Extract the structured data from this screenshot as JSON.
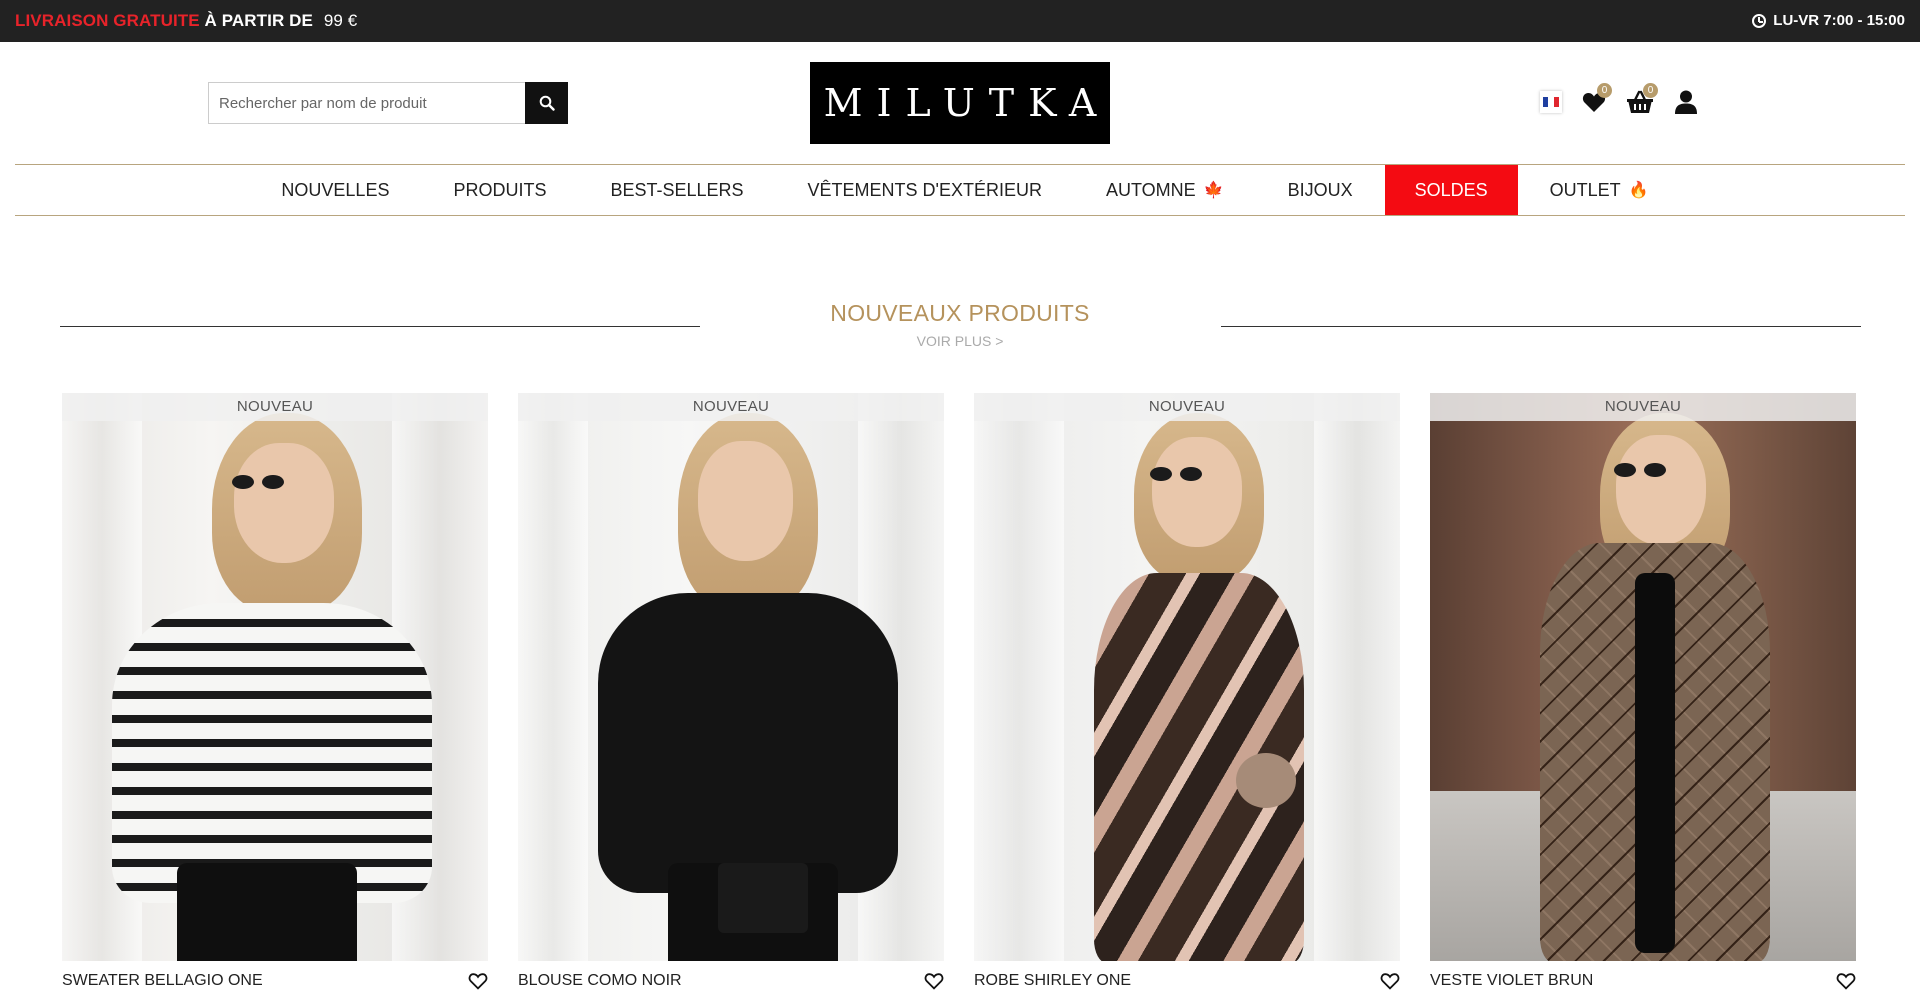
{
  "topbar": {
    "promo_red": "LIVRAISON GRATUITE",
    "promo_white": "À PARTIR DE",
    "promo_price": "99 €",
    "hours": "LU-VR 7:00 - 15:00"
  },
  "header": {
    "search_placeholder": "Rechercher par nom de produit",
    "logo_text": "MILUTKA",
    "wishlist_count": "0",
    "cart_count": "0"
  },
  "nav": {
    "items": [
      {
        "label": "NOUVELLES"
      },
      {
        "label": "PRODUITS"
      },
      {
        "label": "BEST-SELLERS"
      },
      {
        "label": "VÊTEMENTS D'EXTÉRIEUR"
      },
      {
        "label": "AUTOMNE",
        "emoji": "🍁"
      },
      {
        "label": "BIJOUX"
      },
      {
        "label": "SOLDES"
      },
      {
        "label": "OUTLET",
        "emoji": "🔥"
      }
    ]
  },
  "section": {
    "title": "NOUVEAUX PRODUITS",
    "more": "VOIR PLUS >"
  },
  "products": [
    {
      "tag": "NOUVEAU",
      "name": "SWEATER BELLAGIO ONE"
    },
    {
      "tag": "NOUVEAU",
      "name": "BLOUSE COMO NOIR"
    },
    {
      "tag": "NOUVEAU",
      "name": "ROBE SHIRLEY ONE"
    },
    {
      "tag": "NOUVEAU",
      "name": "VESTE VIOLET BRUN"
    }
  ],
  "colors": {
    "topbar_bg": "#222222",
    "promo_red": "#e8232a",
    "sale_bg": "#f40b12",
    "gold": "#b5925c",
    "badge": "#b79c6b"
  }
}
